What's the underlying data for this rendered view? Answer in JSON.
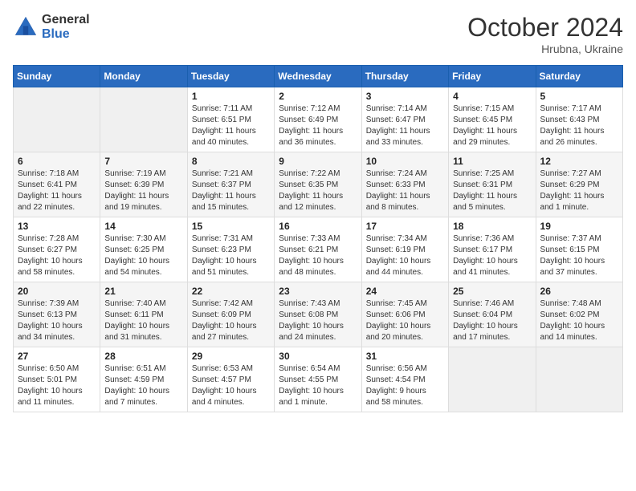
{
  "header": {
    "logo_line1": "General",
    "logo_line2": "Blue",
    "month_year": "October 2024",
    "location": "Hrubna, Ukraine"
  },
  "weekdays": [
    "Sunday",
    "Monday",
    "Tuesday",
    "Wednesday",
    "Thursday",
    "Friday",
    "Saturday"
  ],
  "weeks": [
    [
      {
        "day": "",
        "info": ""
      },
      {
        "day": "",
        "info": ""
      },
      {
        "day": "1",
        "info": "Sunrise: 7:11 AM\nSunset: 6:51 PM\nDaylight: 11 hours\nand 40 minutes."
      },
      {
        "day": "2",
        "info": "Sunrise: 7:12 AM\nSunset: 6:49 PM\nDaylight: 11 hours\nand 36 minutes."
      },
      {
        "day": "3",
        "info": "Sunrise: 7:14 AM\nSunset: 6:47 PM\nDaylight: 11 hours\nand 33 minutes."
      },
      {
        "day": "4",
        "info": "Sunrise: 7:15 AM\nSunset: 6:45 PM\nDaylight: 11 hours\nand 29 minutes."
      },
      {
        "day": "5",
        "info": "Sunrise: 7:17 AM\nSunset: 6:43 PM\nDaylight: 11 hours\nand 26 minutes."
      }
    ],
    [
      {
        "day": "6",
        "info": "Sunrise: 7:18 AM\nSunset: 6:41 PM\nDaylight: 11 hours\nand 22 minutes."
      },
      {
        "day": "7",
        "info": "Sunrise: 7:19 AM\nSunset: 6:39 PM\nDaylight: 11 hours\nand 19 minutes."
      },
      {
        "day": "8",
        "info": "Sunrise: 7:21 AM\nSunset: 6:37 PM\nDaylight: 11 hours\nand 15 minutes."
      },
      {
        "day": "9",
        "info": "Sunrise: 7:22 AM\nSunset: 6:35 PM\nDaylight: 11 hours\nand 12 minutes."
      },
      {
        "day": "10",
        "info": "Sunrise: 7:24 AM\nSunset: 6:33 PM\nDaylight: 11 hours\nand 8 minutes."
      },
      {
        "day": "11",
        "info": "Sunrise: 7:25 AM\nSunset: 6:31 PM\nDaylight: 11 hours\nand 5 minutes."
      },
      {
        "day": "12",
        "info": "Sunrise: 7:27 AM\nSunset: 6:29 PM\nDaylight: 11 hours\nand 1 minute."
      }
    ],
    [
      {
        "day": "13",
        "info": "Sunrise: 7:28 AM\nSunset: 6:27 PM\nDaylight: 10 hours\nand 58 minutes."
      },
      {
        "day": "14",
        "info": "Sunrise: 7:30 AM\nSunset: 6:25 PM\nDaylight: 10 hours\nand 54 minutes."
      },
      {
        "day": "15",
        "info": "Sunrise: 7:31 AM\nSunset: 6:23 PM\nDaylight: 10 hours\nand 51 minutes."
      },
      {
        "day": "16",
        "info": "Sunrise: 7:33 AM\nSunset: 6:21 PM\nDaylight: 10 hours\nand 48 minutes."
      },
      {
        "day": "17",
        "info": "Sunrise: 7:34 AM\nSunset: 6:19 PM\nDaylight: 10 hours\nand 44 minutes."
      },
      {
        "day": "18",
        "info": "Sunrise: 7:36 AM\nSunset: 6:17 PM\nDaylight: 10 hours\nand 41 minutes."
      },
      {
        "day": "19",
        "info": "Sunrise: 7:37 AM\nSunset: 6:15 PM\nDaylight: 10 hours\nand 37 minutes."
      }
    ],
    [
      {
        "day": "20",
        "info": "Sunrise: 7:39 AM\nSunset: 6:13 PM\nDaylight: 10 hours\nand 34 minutes."
      },
      {
        "day": "21",
        "info": "Sunrise: 7:40 AM\nSunset: 6:11 PM\nDaylight: 10 hours\nand 31 minutes."
      },
      {
        "day": "22",
        "info": "Sunrise: 7:42 AM\nSunset: 6:09 PM\nDaylight: 10 hours\nand 27 minutes."
      },
      {
        "day": "23",
        "info": "Sunrise: 7:43 AM\nSunset: 6:08 PM\nDaylight: 10 hours\nand 24 minutes."
      },
      {
        "day": "24",
        "info": "Sunrise: 7:45 AM\nSunset: 6:06 PM\nDaylight: 10 hours\nand 20 minutes."
      },
      {
        "day": "25",
        "info": "Sunrise: 7:46 AM\nSunset: 6:04 PM\nDaylight: 10 hours\nand 17 minutes."
      },
      {
        "day": "26",
        "info": "Sunrise: 7:48 AM\nSunset: 6:02 PM\nDaylight: 10 hours\nand 14 minutes."
      }
    ],
    [
      {
        "day": "27",
        "info": "Sunrise: 6:50 AM\nSunset: 5:01 PM\nDaylight: 10 hours\nand 11 minutes."
      },
      {
        "day": "28",
        "info": "Sunrise: 6:51 AM\nSunset: 4:59 PM\nDaylight: 10 hours\nand 7 minutes."
      },
      {
        "day": "29",
        "info": "Sunrise: 6:53 AM\nSunset: 4:57 PM\nDaylight: 10 hours\nand 4 minutes."
      },
      {
        "day": "30",
        "info": "Sunrise: 6:54 AM\nSunset: 4:55 PM\nDaylight: 10 hours\nand 1 minute."
      },
      {
        "day": "31",
        "info": "Sunrise: 6:56 AM\nSunset: 4:54 PM\nDaylight: 9 hours\nand 58 minutes."
      },
      {
        "day": "",
        "info": ""
      },
      {
        "day": "",
        "info": ""
      }
    ]
  ]
}
